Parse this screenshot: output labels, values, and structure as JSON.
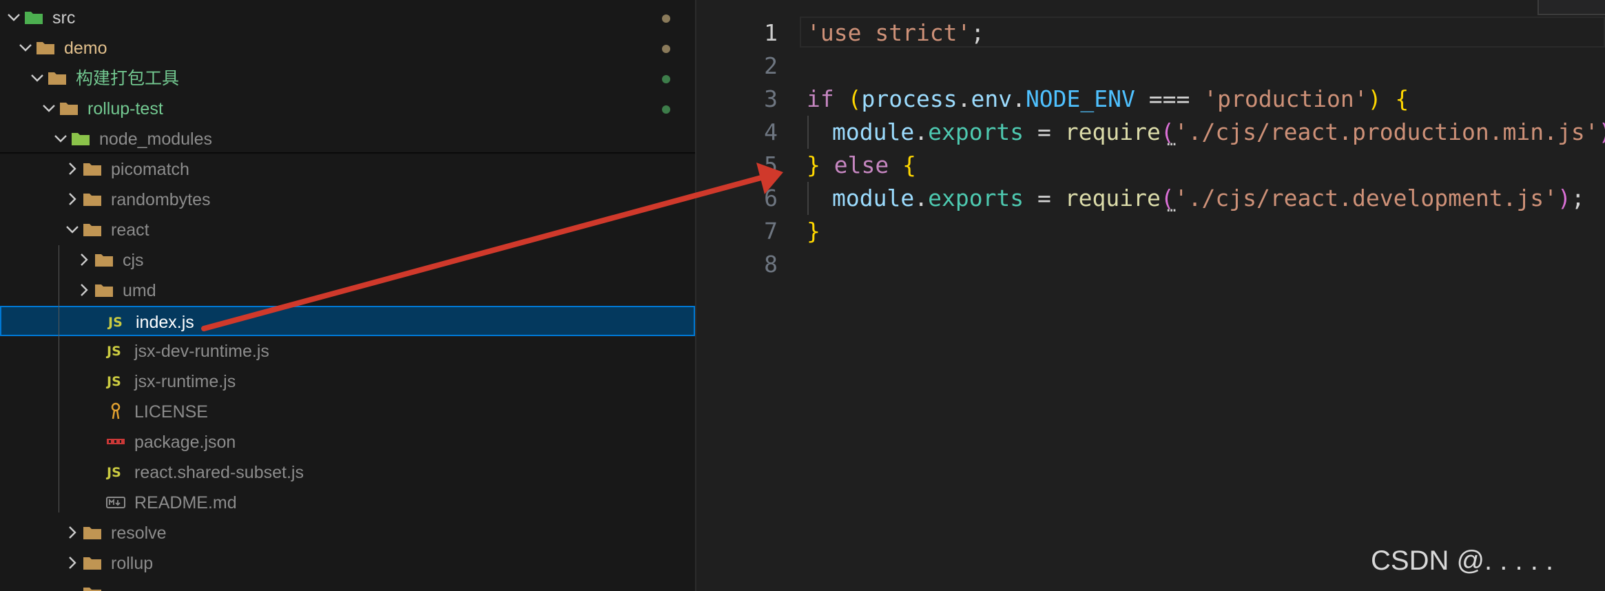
{
  "explorer": {
    "items": [
      {
        "label": "src",
        "expanded": true,
        "kind": "folder-src",
        "label_color": "#cccccc",
        "dot": "#8a7a5a"
      },
      {
        "label": "demo",
        "expanded": true,
        "kind": "folder",
        "label_color": "#e2c08d",
        "dot": "#8a7a5a"
      },
      {
        "label": "构建打包工具",
        "expanded": true,
        "kind": "folder",
        "label_color": "#73c991",
        "dot": "#3d7d4a"
      },
      {
        "label": "rollup-test",
        "expanded": true,
        "kind": "folder",
        "label_color": "#73c991",
        "dot": "#3d7d4a"
      },
      {
        "label": "node_modules",
        "expanded": true,
        "kind": "folder-node",
        "label_color": "#8c8c8c"
      },
      {
        "label": "picomatch",
        "expanded": false,
        "kind": "folder",
        "label_color": "#8c8c8c"
      },
      {
        "label": "randombytes",
        "expanded": false,
        "kind": "folder",
        "label_color": "#8c8c8c"
      },
      {
        "label": "react",
        "expanded": true,
        "kind": "folder",
        "label_color": "#8c8c8c"
      },
      {
        "label": "cjs",
        "expanded": false,
        "kind": "folder",
        "label_color": "#8c8c8c"
      },
      {
        "label": "umd",
        "expanded": false,
        "kind": "folder",
        "label_color": "#8c8c8c"
      },
      {
        "label": "index.js",
        "kind": "js",
        "label_color": "#ffffff",
        "selected": true
      },
      {
        "label": "jsx-dev-runtime.js",
        "kind": "js",
        "label_color": "#8c8c8c"
      },
      {
        "label": "jsx-runtime.js",
        "kind": "js",
        "label_color": "#8c8c8c"
      },
      {
        "label": "LICENSE",
        "kind": "license",
        "label_color": "#8c8c8c"
      },
      {
        "label": "package.json",
        "kind": "npm",
        "label_color": "#8c8c8c"
      },
      {
        "label": "react.shared-subset.js",
        "kind": "js",
        "label_color": "#8c8c8c"
      },
      {
        "label": "README.md",
        "kind": "markdown",
        "label_color": "#8c8c8c"
      },
      {
        "label": "resolve",
        "expanded": false,
        "kind": "folder",
        "label_color": "#8c8c8c"
      },
      {
        "label": "rollup",
        "expanded": false,
        "kind": "folder",
        "label_color": "#8c8c8c"
      }
    ],
    "js_badge": "JS"
  },
  "editor": {
    "line_numbers": [
      "1",
      "2",
      "3",
      "4",
      "5",
      "6",
      "7",
      "8"
    ],
    "lines": {
      "l1_str": "'use strict'",
      "l1_semi": ";",
      "l3_if": "if",
      "l3_paren_open": "(",
      "l3_process": "process",
      "l3_dot1": ".",
      "l3_env": "env",
      "l3_dot2": ".",
      "l3_node_env": "NODE_ENV",
      "l3_eq": " === ",
      "l3_str": "'production'",
      "l3_paren_close": ")",
      "l3_brace": " {",
      "l4_module": "module",
      "l4_dot": ".",
      "l4_exports": "exports",
      "l4_assign": " = ",
      "l4_require": "require",
      "l4_paren_open": "(",
      "l4_str": "'./cjs/react.production.min.js'",
      "l4_paren_close": ")",
      "l4_semi": ";",
      "l5_brace_close": "}",
      "l5_else": " else ",
      "l5_brace_open": "{",
      "l6_module": "module",
      "l6_dot": ".",
      "l6_exports": "exports",
      "l6_assign": " = ",
      "l6_require": "require",
      "l6_paren_open": "(",
      "l6_str": "'./cjs/react.development.js'",
      "l6_paren_close": ")",
      "l6_semi": ";",
      "l7_brace": "}"
    }
  },
  "watermark": "CSDN @.   . . . .",
  "colors": {
    "selection_bg": "#04395e",
    "selection_border": "#0078d4",
    "arrow": "#d0392b"
  }
}
